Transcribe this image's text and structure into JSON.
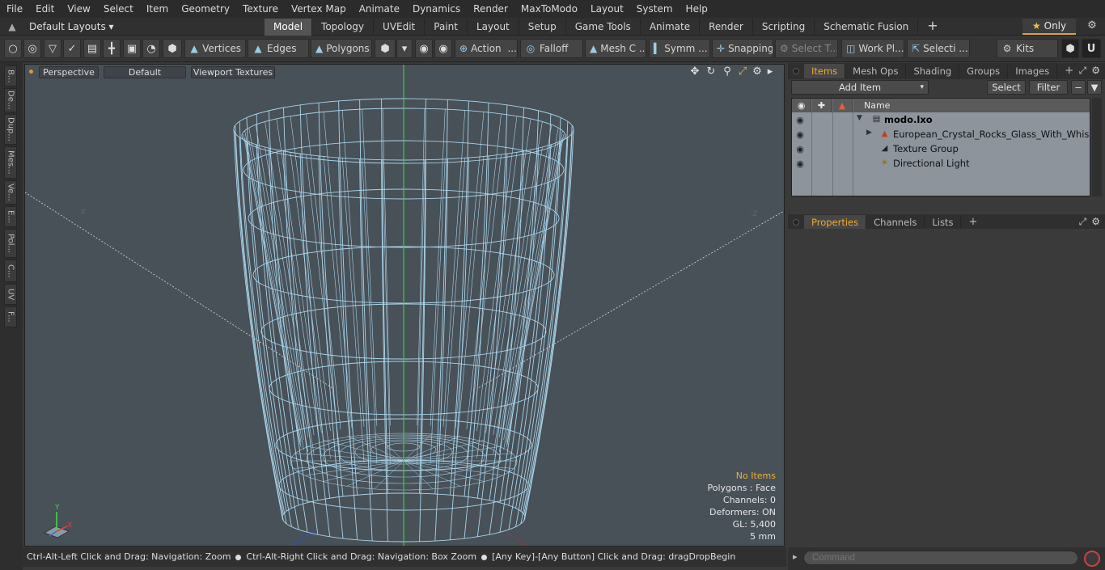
{
  "menu": [
    "File",
    "Edit",
    "View",
    "Select",
    "Item",
    "Geometry",
    "Texture",
    "Vertex Map",
    "Animate",
    "Dynamics",
    "Render",
    "MaxToModo",
    "Layout",
    "System",
    "Help"
  ],
  "layout_selector": "Default Layouts ▾",
  "layout_tabs": [
    "Model",
    "Topology",
    "UVEdit",
    "Paint",
    "Layout",
    "Setup",
    "Game Tools",
    "Animate",
    "Render",
    "Scripting",
    "Schematic Fusion"
  ],
  "active_layout_tab": "Model",
  "only_button": "Only",
  "toolbar": {
    "vertices": "Vertices",
    "edges": "Edges",
    "polygons": "Polygons",
    "action": "Action",
    "falloff": "Falloff",
    "mesh": "Mesh C ...",
    "symm": "Symm ...",
    "snapping": "Snapping",
    "select_t": "Select T...",
    "work_pl": "Work Pl...",
    "selecti": "Selecti ...",
    "kits": "Kits"
  },
  "left_tabs": [
    "B...",
    "De...",
    "Dup...",
    "Mes...",
    "Ve...",
    "E...",
    "Pol...",
    "C...",
    "UV",
    "F..."
  ],
  "viewport": {
    "view_mode": "Perspective",
    "shading": "Default",
    "textures": "Viewport Textures",
    "axis_x_label": "X",
    "axis_y_label": "Y",
    "neg_x": "-X",
    "neg_z": "-Z",
    "info": {
      "items": "No Items",
      "polygons": "Polygons : Face",
      "channels": "Channels: 0",
      "deformers": "Deformers: ON",
      "gl": "GL: 5,400",
      "scale": "5 mm"
    }
  },
  "statusbar": {
    "part1": "Ctrl-Alt-Left Click and Drag: Navigation: Zoom",
    "part2": "Ctrl-Alt-Right Click and Drag: Navigation: Box Zoom",
    "part3": "[Any Key]-[Any Button] Click and Drag: dragDropBegin"
  },
  "items_panel": {
    "tabs": [
      "Items",
      "Mesh Ops",
      "Shading",
      "Groups",
      "Images"
    ],
    "active_tab": "Items",
    "add_item": "Add Item",
    "select": "Select",
    "filter": "Filter",
    "column_name": "Name",
    "rows": [
      {
        "label": "modo.lxo"
      },
      {
        "label": "European_Crystal_Rocks_Glass_With_Whiskey"
      },
      {
        "label": "Texture Group"
      },
      {
        "label": "Directional Light"
      }
    ]
  },
  "properties_panel": {
    "tabs": [
      "Properties",
      "Channels",
      "Lists"
    ],
    "active_tab": "Properties"
  },
  "command": {
    "placeholder": "Command"
  },
  "colors": {
    "accent": "#f0a830",
    "wire": "#a9d4ea",
    "viewport_bg": "#485058"
  }
}
